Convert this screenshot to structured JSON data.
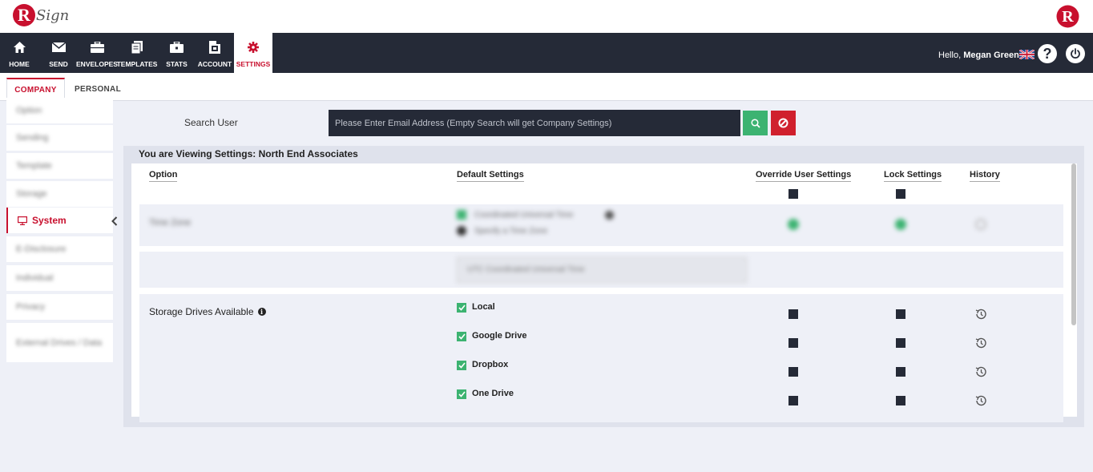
{
  "brand": {
    "logo_letter": "R",
    "logo_script": "Sign",
    "right_logo_letter": "R",
    "color": "#c8102e"
  },
  "nav": {
    "items": [
      {
        "label": "HOME",
        "icon": "home-icon"
      },
      {
        "label": "SEND",
        "icon": "envelope-icon"
      },
      {
        "label": "ENVELOPES",
        "icon": "briefcase-icon"
      },
      {
        "label": "TEMPLATES",
        "icon": "documents-icon"
      },
      {
        "label": "STATS",
        "icon": "toolbox-icon"
      },
      {
        "label": "ACCOUNT",
        "icon": "account-icon"
      },
      {
        "label": "SETTINGS",
        "icon": "gear-icon",
        "active": true
      }
    ],
    "hello_prefix": "Hello,",
    "user_name": "Megan Greene",
    "help_glyph": "?"
  },
  "tabs": [
    {
      "label": "COMPANY",
      "active": true
    },
    {
      "label": "PERSONAL",
      "active": false
    }
  ],
  "sidemenu": {
    "items": [
      {
        "label": "Option",
        "blurred": true
      },
      {
        "label": "Sending",
        "blurred": true
      },
      {
        "label": "Template",
        "blurred": true
      },
      {
        "label": "Storage",
        "blurred": true
      },
      {
        "label": "System",
        "active": true
      },
      {
        "label": "E-Disclosure",
        "blurred": true
      },
      {
        "label": "Individual",
        "blurred": true
      },
      {
        "label": "Privacy",
        "blurred": true
      },
      {
        "label": "External Drives / Data",
        "blurred": true
      }
    ]
  },
  "search": {
    "label": "Search User",
    "placeholder": "Please Enter Email Address (Empty Search will get Company Settings)",
    "value": ""
  },
  "viewing_text": "You are Viewing Settings: North End Associates",
  "table": {
    "headers": {
      "option": "Option",
      "default": "Default Settings",
      "override": "Override User Settings",
      "lock": "Lock Settings",
      "history": "History"
    },
    "blurred_row": {
      "label": "Time Zone",
      "opt1": "Coordinated Universal Time",
      "opt2": "Specify a Time Zone",
      "select_value": "UTC Coordinated Universal Time"
    },
    "storage": {
      "label": "Storage Drives Available",
      "drives": [
        "Local",
        "Google Drive",
        "Dropbox",
        "One Drive"
      ]
    }
  }
}
